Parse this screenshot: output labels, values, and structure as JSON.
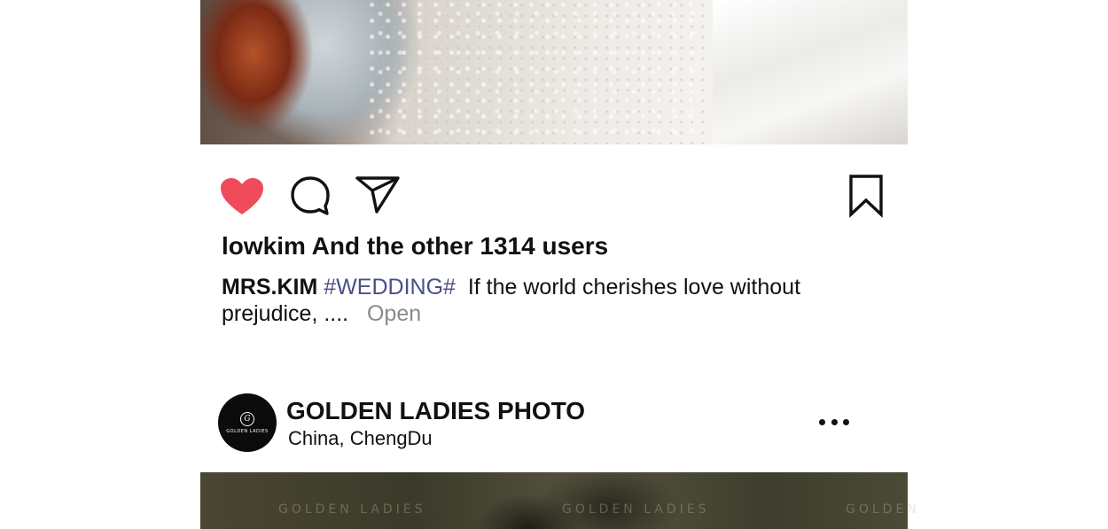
{
  "post_top": {
    "likes_text": "lowkim And the other 1314 users",
    "caption": {
      "username": "MRS.KIM",
      "hashtag": "#WEDDING#",
      "text_line1": "If the world cherishes love without",
      "text_line2": "prejudice, ....",
      "more_label": "Open"
    },
    "icons": {
      "like": "heart-icon",
      "comment": "comment-bubble-icon",
      "share": "paper-plane-icon",
      "save": "bookmark-icon"
    },
    "colors": {
      "like_active": "#f04b5a",
      "hashtag": "#4a4f86",
      "muted": "#8a8a8a"
    }
  },
  "post_bottom": {
    "account_name": "GOLDEN LADIES PHOTO",
    "location_country": "China,",
    "location_city": "ChengDu",
    "avatar_logo_text": "GOLDEN LADIES",
    "menu_icon": "more-dots-icon"
  }
}
